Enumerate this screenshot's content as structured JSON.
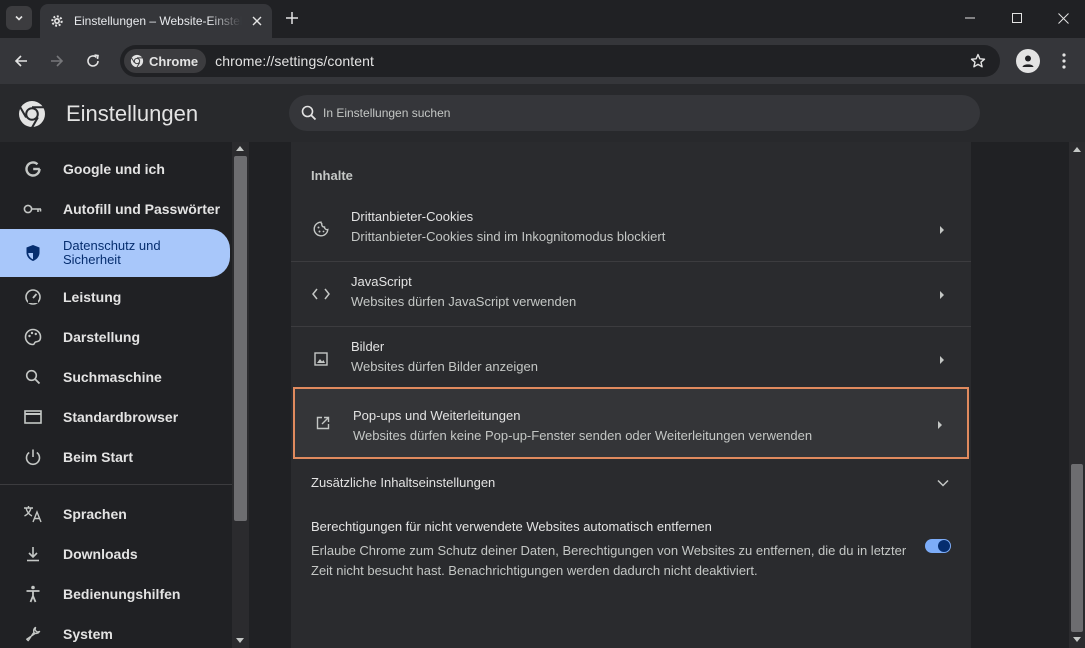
{
  "browser": {
    "tab_title": "Einstellungen – Website-Einstellungen",
    "chip_label": "Chrome",
    "url": "chrome://settings/content"
  },
  "header": {
    "title": "Einstellungen",
    "search_placeholder": "In Einstellungen suchen"
  },
  "sidebar": {
    "items": [
      {
        "label": "Google und ich",
        "icon": "google-icon"
      },
      {
        "label": "Autofill und Passwörter",
        "icon": "key-icon"
      },
      {
        "label": "Datenschutz und Sicherheit",
        "icon": "shield-icon",
        "active": true
      },
      {
        "label": "Leistung",
        "icon": "speedometer-icon"
      },
      {
        "label": "Darstellung",
        "icon": "palette-icon"
      },
      {
        "label": "Suchmaschine",
        "icon": "search-icon"
      },
      {
        "label": "Standardbrowser",
        "icon": "browser-window-icon"
      },
      {
        "label": "Beim Start",
        "icon": "power-icon"
      },
      {
        "label": "Sprachen",
        "icon": "translate-icon"
      },
      {
        "label": "Downloads",
        "icon": "download-icon"
      },
      {
        "label": "Bedienungshilfen",
        "icon": "accessibility-icon"
      },
      {
        "label": "System",
        "icon": "wrench-icon"
      }
    ]
  },
  "content": {
    "section_title": "Inhalte",
    "rows": [
      {
        "title": "Drittanbieter-Cookies",
        "subtitle": "Drittanbieter-Cookies sind im Inkognitomodus blockiert",
        "icon": "cookie-icon"
      },
      {
        "title": "JavaScript",
        "subtitle": "Websites dürfen JavaScript verwenden",
        "icon": "code-icon"
      },
      {
        "title": "Bilder",
        "subtitle": "Websites dürfen Bilder anzeigen",
        "icon": "image-icon"
      },
      {
        "title": "Pop-ups und Weiterleitungen",
        "subtitle": "Websites dürfen keine Pop-up-Fenster senden oder Weiterleitungen verwenden",
        "icon": "open-external-icon",
        "highlighted": true
      }
    ],
    "additional_label": "Zusätzliche Inhaltseinstellungen",
    "permission_title": "Berechtigungen für nicht verwendete Websites automatisch entfernen",
    "permission_desc": "Erlaube Chrome zum Schutz deiner Daten, Berechtigungen von Websites zu entfernen, die du in letzter Zeit nicht besucht hast. Benachrichtigungen werden dadurch nicht deaktiviert.",
    "permission_toggle_on": true
  },
  "colors": {
    "accent": "#a8c7fa",
    "highlight_border": "#e08a5e",
    "toggle": "#7cacf8"
  }
}
